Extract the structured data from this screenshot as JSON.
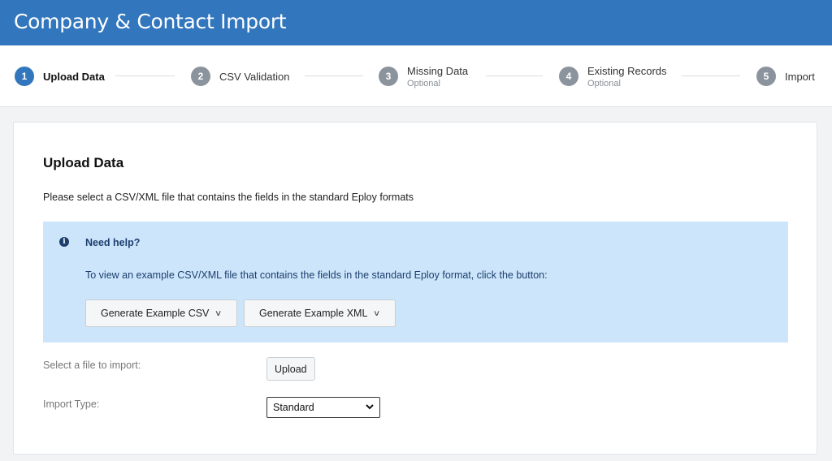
{
  "header": {
    "title": "Company & Contact Import"
  },
  "steps": [
    {
      "num": "1",
      "label": "Upload Data",
      "sub": ""
    },
    {
      "num": "2",
      "label": "CSV Validation",
      "sub": ""
    },
    {
      "num": "3",
      "label": "Missing Data",
      "sub": "Optional"
    },
    {
      "num": "4",
      "label": "Existing Records",
      "sub": "Optional"
    },
    {
      "num": "5",
      "label": "Import",
      "sub": ""
    }
  ],
  "active_step": 1,
  "main": {
    "title": "Upload Data",
    "description": "Please select a CSV/XML file that contains the fields in the standard Eploy formats",
    "help": {
      "icon": "info-icon",
      "title": "Need help?",
      "text": "To view an example CSV/XML file that contains the fields in the standard Eploy format, click the button:",
      "csv_button": "Generate Example CSV",
      "xml_button": "Generate Example XML"
    },
    "file_label": "Select a file to import:",
    "upload_button": "Upload",
    "import_type_label": "Import Type:",
    "import_type_value": "Standard"
  },
  "colors": {
    "header": "#3276bd",
    "active_step": "#3276bd",
    "inactive_step": "#8b939c",
    "help_bg": "#cce5fb",
    "help_text": "#1d3f6e"
  }
}
